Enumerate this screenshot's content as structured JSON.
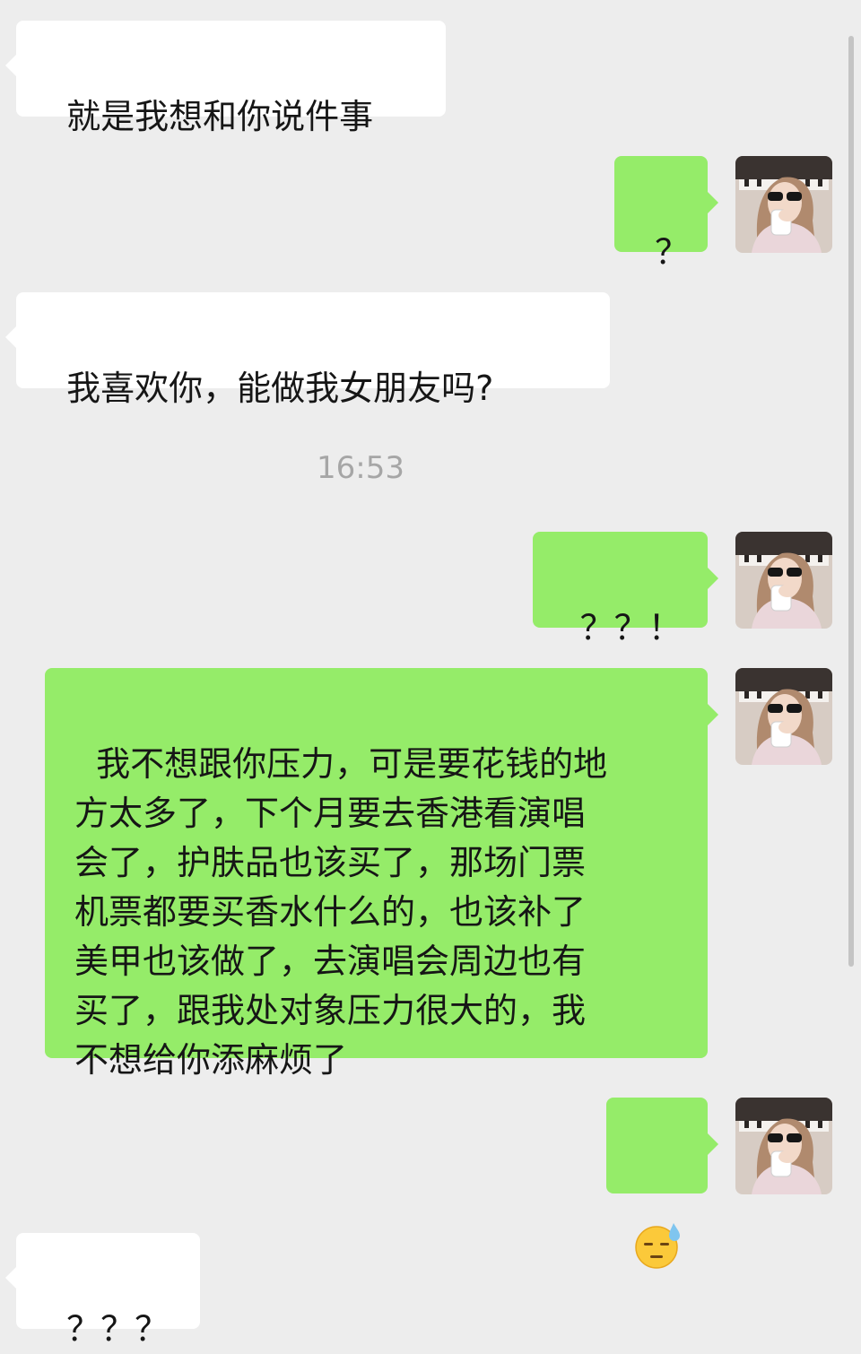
{
  "messages": [
    {
      "side": "received",
      "text": "就是我想和你说件事"
    },
    {
      "side": "sent",
      "text": "？"
    },
    {
      "side": "received",
      "text": "我喜欢你，能做我女朋友吗?"
    },
    {
      "side": "sent",
      "text": "？？！"
    },
    {
      "side": "sent",
      "text": "我不想跟你压力，可是要花钱的地\n方太多了，下个月要去香港看演唱\n会了，护肤品也该买了，那场门票\n机票都要买香水什么的，也该补了\n美甲也该做了，去演唱会周边也有\n买了，跟我处对象压力很大的，我\n不想给你添麻烦了"
    },
    {
      "side": "sent",
      "icon": "sweat-face-emoji-icon"
    },
    {
      "side": "received",
      "text": "？？？"
    }
  ],
  "timestamp": "16:53",
  "colors": {
    "background": "#ededed",
    "received_bubble": "#ffffff",
    "sent_bubble": "#95ec69",
    "timestamp_text": "#a6a6a6"
  }
}
